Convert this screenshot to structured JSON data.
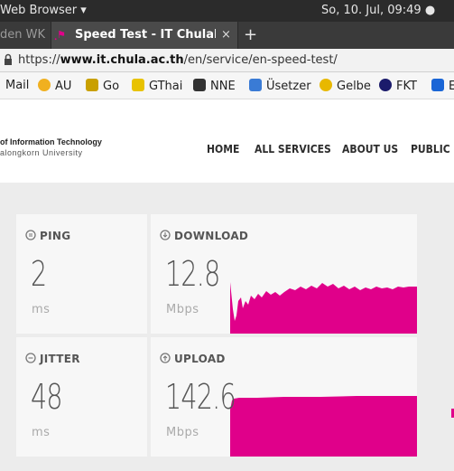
{
  "topbar": {
    "app_name": "Web Browser ▾",
    "clock": "So, 10. Jul, 09:49 ●"
  },
  "tabs": {
    "prev_title": "den WK",
    "active_title": "Speed Test - IT Chulalongk",
    "close_glyph": "×",
    "new_glyph": "+"
  },
  "urlbar": {
    "url_prefix": "https://",
    "url_domain": "www.it.chula.ac.th",
    "url_path": "/en/service/en-speed-test/"
  },
  "bookmarks": [
    {
      "label": "Mail",
      "color": "#00000000"
    },
    {
      "label": "AU",
      "color": "#f0b020"
    },
    {
      "label": "Go",
      "color": "#c9a000"
    },
    {
      "label": "GThai",
      "color": "#e8c200"
    },
    {
      "label": "NNE",
      "color": "#333333"
    },
    {
      "label": "Üsetzer",
      "color": "#3a7bd5"
    },
    {
      "label": "Gelbe",
      "color": "#e8b800"
    },
    {
      "label": "FKT",
      "color": "#1b1b6b"
    },
    {
      "label": "E",
      "color": "#1a66d6"
    }
  ],
  "site": {
    "logo_line1": "of Information Technology",
    "logo_line2": "alongkorn University",
    "nav": [
      "HOME",
      "ALL SERVICES",
      "ABOUT US",
      "PUBLIC R"
    ]
  },
  "speedtest": {
    "accent_color": "#e0008a",
    "ping": {
      "label": "PING",
      "value": "2",
      "unit": "ms"
    },
    "jitter": {
      "label": "JITTER",
      "value": "48",
      "unit": "ms"
    },
    "download": {
      "label": "DOWNLOAD",
      "value": "12.8",
      "unit": "Mbps"
    },
    "upload": {
      "label": "UPLOAD",
      "value": "142.6",
      "unit": "Mbps"
    }
  }
}
